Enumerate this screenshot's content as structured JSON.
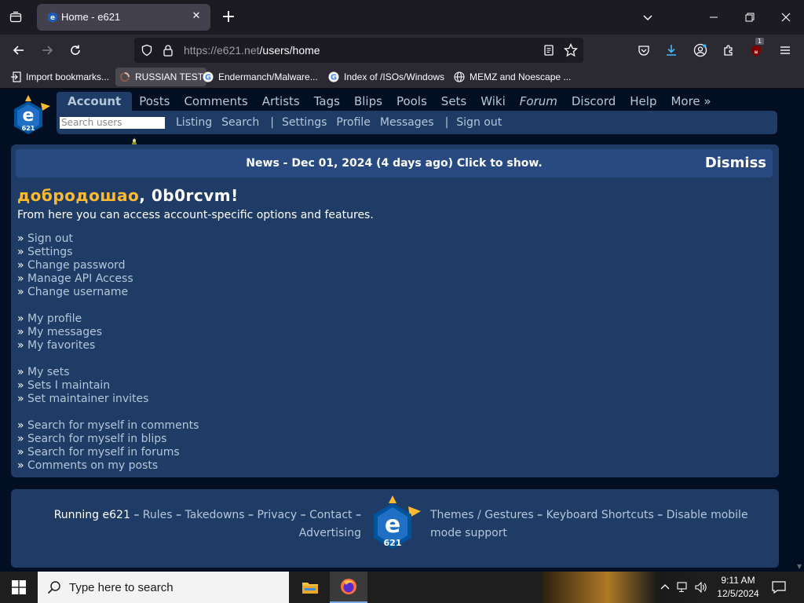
{
  "browser": {
    "tab_title": "Home - e621",
    "url_host": "https://e621.net",
    "url_path": "/users/home",
    "bookmarks": [
      {
        "label": "Import bookmarks...",
        "icon": "import-icon"
      },
      {
        "label": "RUSSIAN TEST",
        "icon": "loading-icon"
      },
      {
        "label": "Endermanch/Malware...",
        "icon": "google-icon"
      },
      {
        "label": "Index of /ISOs/Windows",
        "icon": "google-icon"
      },
      {
        "label": "MEMZ and Noescape ...",
        "icon": "globe-icon"
      }
    ],
    "ublock_badge": "1"
  },
  "site": {
    "main_nav": [
      "Account",
      "Posts",
      "Comments",
      "Artists",
      "Tags",
      "Blips",
      "Pools",
      "Sets",
      "Wiki",
      "Forum",
      "Discord",
      "Help",
      "More »"
    ],
    "search_placeholder": "Search users",
    "sub_nav": [
      "Listing",
      "Search",
      "Settings",
      "Profile",
      "Messages",
      "Sign out"
    ],
    "news_text": "News - Dec 01, 2024 (4 days ago) Click to show.",
    "dismiss_label": "Dismiss",
    "greeting_word": "добродошао",
    "greeting_rest": ", 0b0rcvm!",
    "intro": "From here you can access account-specific options and features.",
    "link_groups": [
      [
        "Sign out",
        "Settings",
        "Change password",
        "Manage API Access",
        "Change username"
      ],
      [
        "My profile",
        "My messages",
        "My favorites"
      ],
      [
        "My sets",
        "Sets I maintain",
        "Set maintainer invites"
      ],
      [
        "Search for myself in comments",
        "Search for myself in blips",
        "Search for myself in forums",
        "Comments on my posts"
      ]
    ],
    "bullet": "»",
    "footer": {
      "running": "Running e621",
      "left_links": [
        "Rules",
        "Takedowns",
        "Privacy",
        "Contact",
        "Advertising"
      ],
      "right_links": [
        "Themes / Gestures",
        "Keyboard Shortcuts",
        "Disable mobile mode support"
      ],
      "dash": "–"
    }
  },
  "taskbar": {
    "search_placeholder": "Type here to search",
    "time": "9:11 AM",
    "date": "12/5/2024"
  },
  "colors": {
    "page_bg": "#020f23",
    "panel_bg": "#1f3c67",
    "link": "#b4c7d9",
    "greeting_accent": "#fdba31"
  }
}
